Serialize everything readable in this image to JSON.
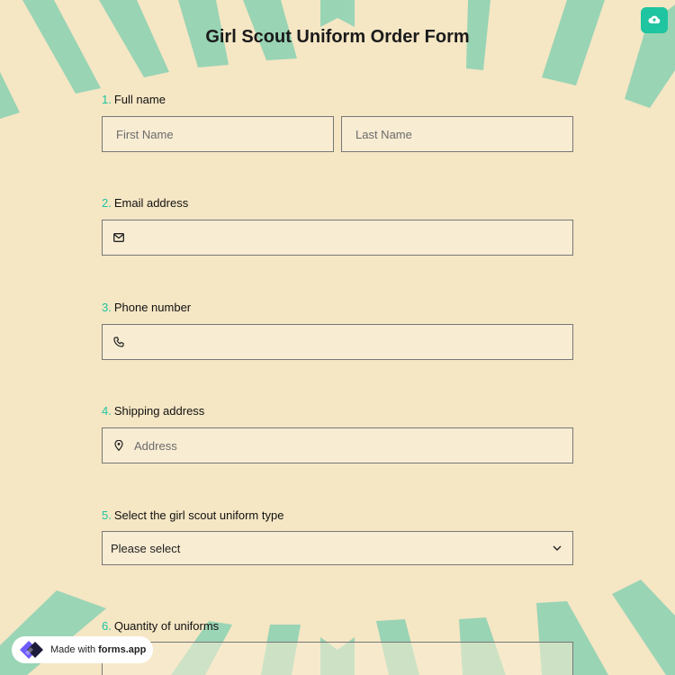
{
  "form": {
    "title": "Girl Scout Uniform Order Form",
    "questions": [
      {
        "number": "1.",
        "label": "Full name",
        "first_placeholder": "First Name",
        "last_placeholder": "Last Name"
      },
      {
        "number": "2.",
        "label": "Email address",
        "icon": "envelope-icon"
      },
      {
        "number": "3.",
        "label": "Phone number",
        "icon": "phone-icon"
      },
      {
        "number": "4.",
        "label": "Shipping address",
        "icon": "location-pin-icon",
        "placeholder": "Address"
      },
      {
        "number": "5.",
        "label": "Select the girl scout uniform type",
        "selected": "Please select"
      },
      {
        "number": "6.",
        "label": "Quantity of uniforms"
      }
    ]
  },
  "toolbar": {
    "cloud_icon": "cloud-upload-icon"
  },
  "badge": {
    "prefix": "Made with",
    "brand": "forms.app"
  },
  "colors": {
    "background": "#f5e6c4",
    "accent": "#1fc4a0",
    "rays": "#8fd3b2",
    "field_bg": "#f8ecd3"
  }
}
